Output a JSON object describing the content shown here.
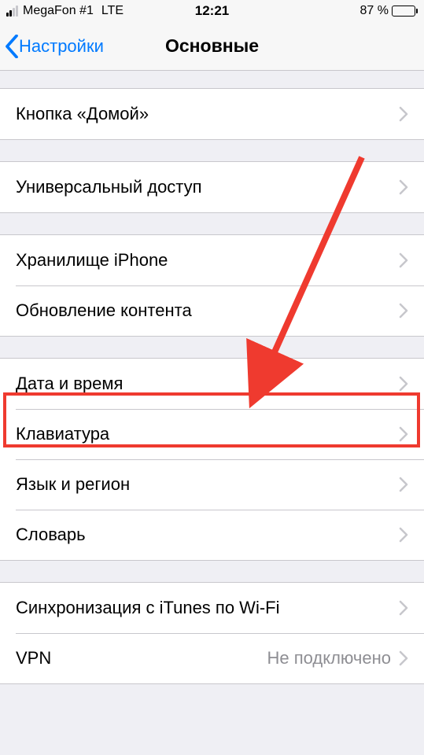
{
  "status": {
    "carrier": "MegaFon #1",
    "network": "LTE",
    "time": "12:21",
    "battery_text": "87 %"
  },
  "nav": {
    "back": "Настройки",
    "title": "Основные"
  },
  "groups": [
    {
      "rows": [
        {
          "label": "Кнопка «Домой»",
          "detail": ""
        }
      ]
    },
    {
      "rows": [
        {
          "label": "Универсальный доступ",
          "detail": ""
        }
      ]
    },
    {
      "rows": [
        {
          "label": "Хранилище iPhone",
          "detail": ""
        },
        {
          "label": "Обновление контента",
          "detail": ""
        }
      ]
    },
    {
      "rows": [
        {
          "label": "Дата и время",
          "detail": ""
        },
        {
          "label": "Клавиатура",
          "detail": ""
        },
        {
          "label": "Язык и регион",
          "detail": ""
        },
        {
          "label": "Словарь",
          "detail": ""
        }
      ]
    },
    {
      "rows": [
        {
          "label": "Синхронизация с iTunes по Wi-Fi",
          "detail": ""
        },
        {
          "label": "VPN",
          "detail": "Не подключено"
        }
      ]
    }
  ]
}
